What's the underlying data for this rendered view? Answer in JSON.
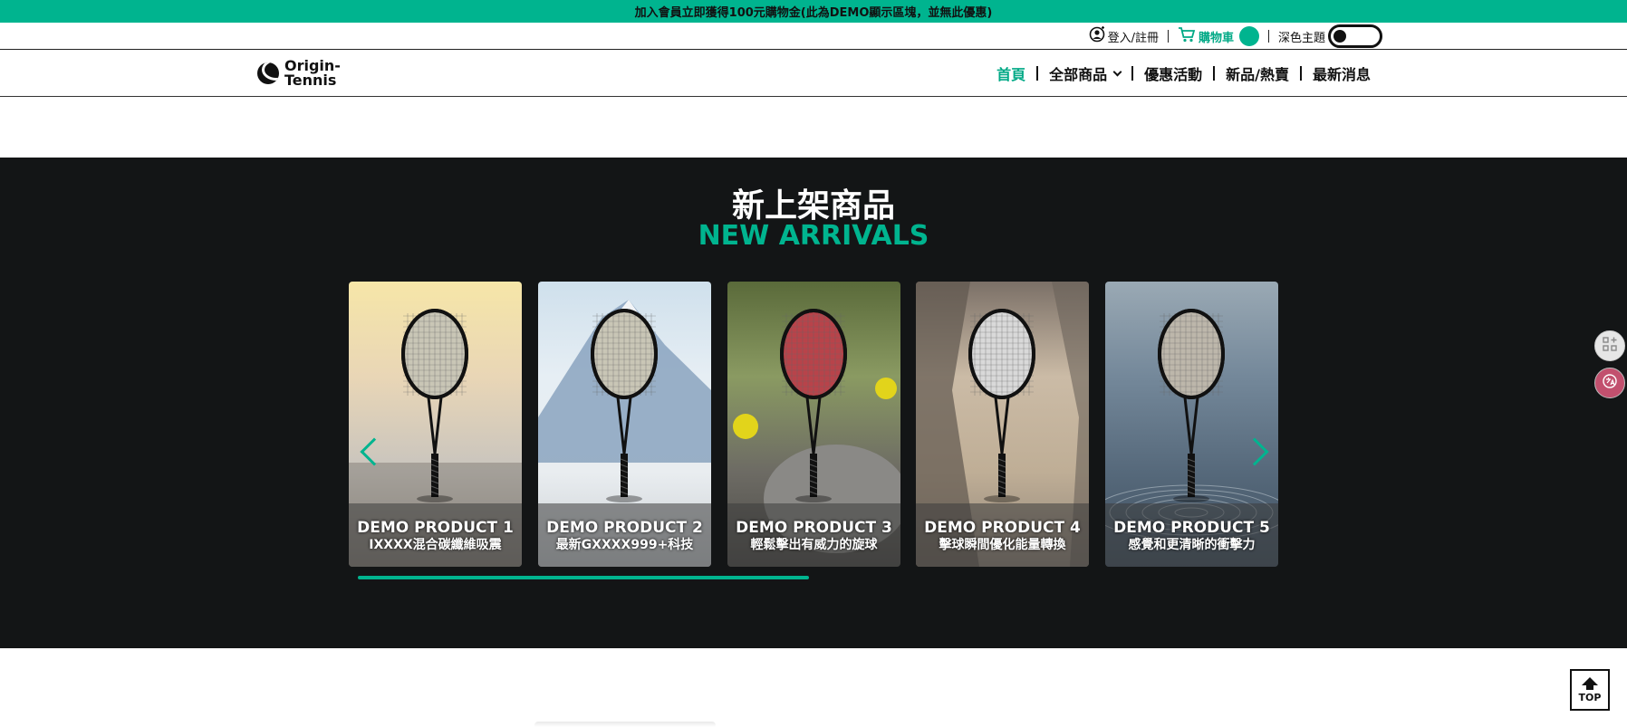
{
  "promo": {
    "text": "加入會員立即獲得100元購物金(此為DEMO顯示區塊，並無此優惠)"
  },
  "utility": {
    "login_label": "登入/註冊",
    "cart_label": "購物車",
    "theme_label": "深色主題",
    "theme_dark_on": false
  },
  "logo": {
    "line1": "Origin-",
    "line2": "Tennis"
  },
  "nav": {
    "items": [
      {
        "label": "首頁",
        "active": true
      },
      {
        "label": "全部商品",
        "has_dropdown": true
      },
      {
        "label": "優惠活動"
      },
      {
        "label": "新品/熱賣"
      },
      {
        "label": "最新消息"
      }
    ]
  },
  "arrivals": {
    "title_cn": "新上架商品",
    "title_en": "NEW ARRIVALS",
    "products": [
      {
        "name": "DEMO PRODUCT 1",
        "tagline": "IXXXX混合碳纖維吸震",
        "scene": "sunset",
        "string_color": "#c9c6b6"
      },
      {
        "name": "DEMO PRODUCT 2",
        "tagline": "最新GXXXX999+科技",
        "scene": "mountain",
        "string_color": "#c9c6b6"
      },
      {
        "name": "DEMO PRODUCT 3",
        "tagline": "輕鬆擊出有威力的旋球",
        "scene": "garden",
        "string_color": "#b8434a"
      },
      {
        "name": "DEMO PRODUCT 4",
        "tagline": "擊球瞬間優化能量轉換",
        "scene": "sand",
        "string_color": "#d9d9d9"
      },
      {
        "name": "DEMO PRODUCT 5",
        "tagline": "感覺和更清晰的衝擊力",
        "scene": "water",
        "string_color": "#bdb7ab"
      }
    ],
    "carousel_progress": 0.5
  },
  "back_to_top": {
    "label": "TOP"
  },
  "colors": {
    "accent": "#00b48f",
    "dark_section": "#131516"
  }
}
